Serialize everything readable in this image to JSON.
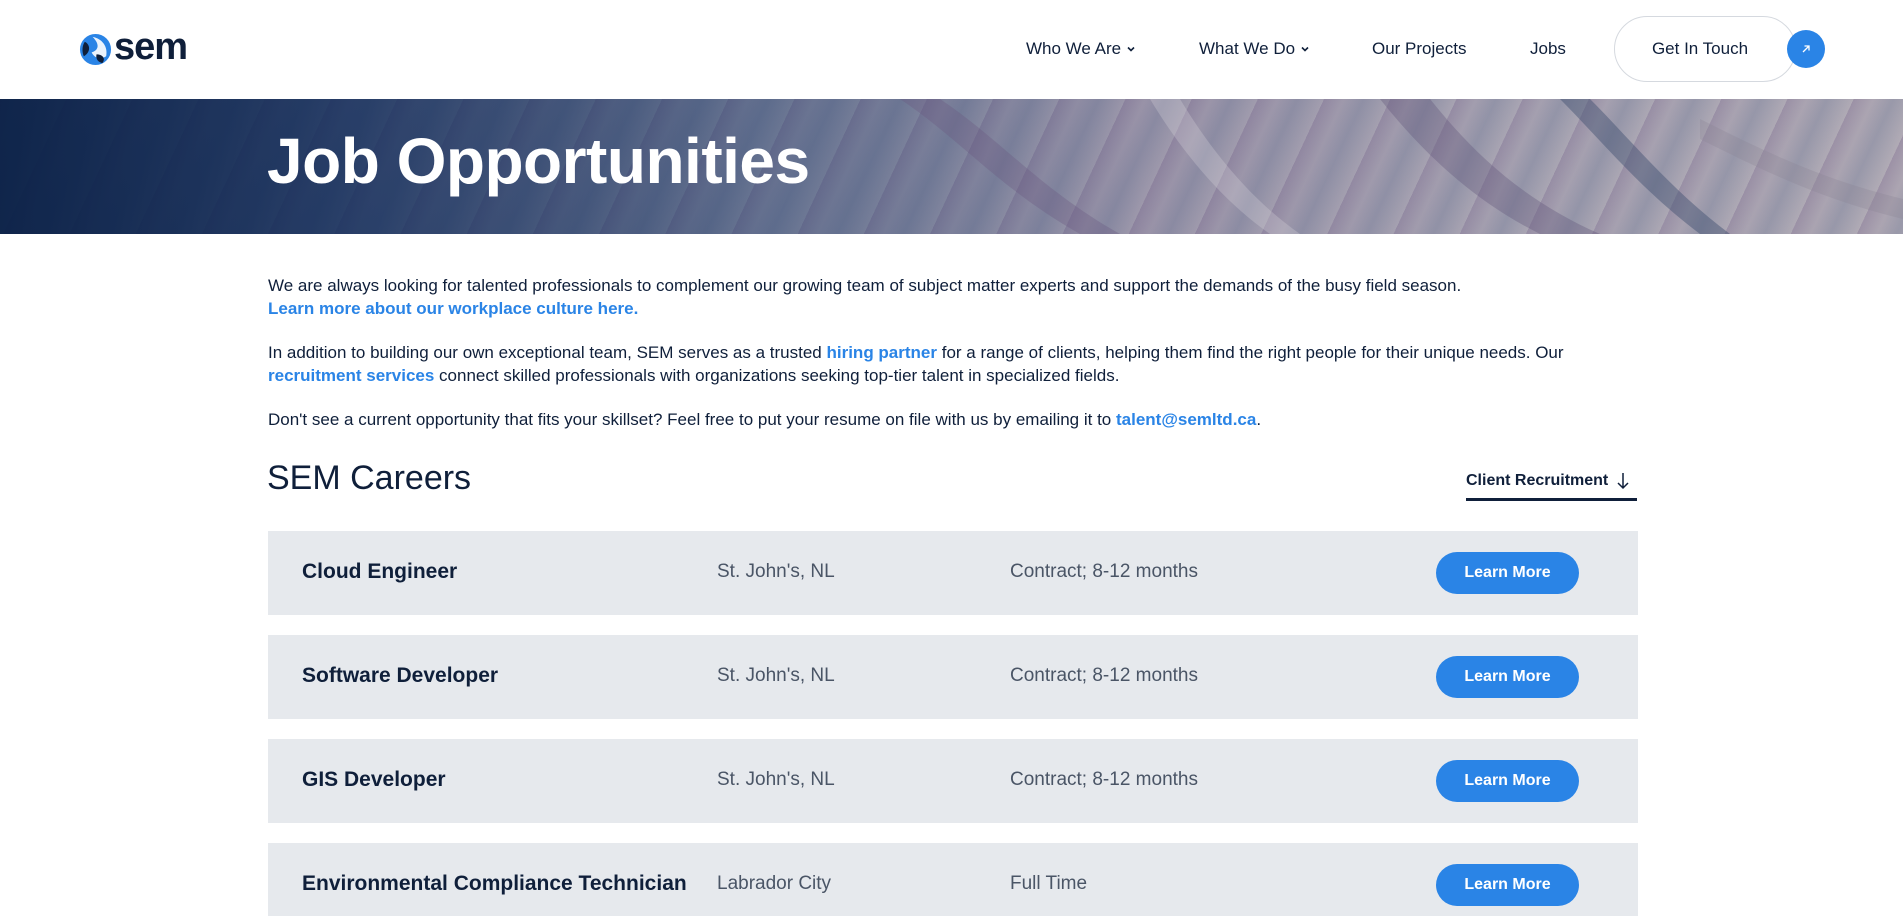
{
  "header": {
    "logo_text": "sem",
    "nav": {
      "who_we_are": "Who We Are",
      "what_we_do": "What We Do",
      "our_projects": "Our Projects",
      "jobs": "Jobs"
    },
    "cta_label": "Get In Touch",
    "cta_icon": "arrow-up-right-icon"
  },
  "hero": {
    "title": "Job Opportunities"
  },
  "intro": {
    "p1_text": "We are always looking for talented professionals to complement our growing team of subject matter experts and support the demands of the busy field season.",
    "p1_link": "Learn more about our workplace culture here.",
    "p2_before": "In addition to building our own exceptional team, SEM serves as a trusted ",
    "p2_link1": "hiring partner",
    "p2_middle": " for a range of clients, helping them find the right people for their unique needs. Our",
    "p2_link2": "recruitment services",
    "p2_after": " connect skilled professionals with organizations seeking top-tier talent in specialized fields.",
    "p3_before": "Don't see a current opportunity that fits your skillset? Feel free to put your resume on file with us by emailing it to ",
    "p3_email": "talent@semltd.ca",
    "p3_after": "."
  },
  "careers": {
    "title": "SEM Careers",
    "client_tab": "Client Recruitment",
    "jobs": [
      {
        "title": "Cloud Engineer",
        "location": "St. John's, NL",
        "type": "Contract; 8-12 months",
        "button": "Learn More"
      },
      {
        "title": "Software Developer",
        "location": "St. John's, NL",
        "type": "Contract; 8-12 months",
        "button": "Learn More"
      },
      {
        "title": "GIS Developer",
        "location": "St. John's, NL",
        "type": "Contract; 8-12 months",
        "button": "Learn More"
      },
      {
        "title": "Environmental Compliance Technician",
        "location": "Labrador City",
        "type": "Full Time",
        "button": "Learn More"
      }
    ]
  },
  "colors": {
    "accent": "#2a84e6",
    "navy": "#0f1f3a",
    "row_bg": "#e6e9ed"
  }
}
